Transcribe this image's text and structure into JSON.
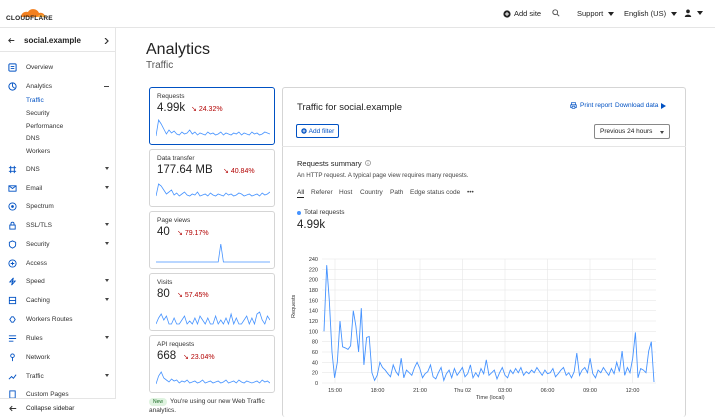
{
  "topbar": {
    "logo_text": "CLOUDFLARE",
    "add_site": "Add site",
    "support": "Support",
    "language": "English (US)"
  },
  "sidebar": {
    "domain": "social.example",
    "items": [
      {
        "label": "Overview",
        "icon": "overview-icon"
      },
      {
        "label": "Analytics",
        "icon": "analytics-icon"
      },
      {
        "label": "DNS",
        "icon": "dns-icon"
      },
      {
        "label": "Email",
        "icon": "email-icon"
      },
      {
        "label": "Spectrum",
        "icon": "spectrum-icon"
      },
      {
        "label": "SSL/TLS",
        "icon": "lock-icon"
      },
      {
        "label": "Security",
        "icon": "shield-icon"
      },
      {
        "label": "Access",
        "icon": "access-icon"
      },
      {
        "label": "Speed",
        "icon": "lightning-icon"
      },
      {
        "label": "Caching",
        "icon": "caching-icon"
      },
      {
        "label": "Workers Routes",
        "icon": "workers-icon"
      },
      {
        "label": "Rules",
        "icon": "rules-icon"
      },
      {
        "label": "Network",
        "icon": "network-icon"
      },
      {
        "label": "Traffic",
        "icon": "traffic-icon"
      },
      {
        "label": "Custom Pages",
        "icon": "pages-icon"
      }
    ],
    "analytics_sub": [
      "Traffic",
      "Security",
      "Performance",
      "DNS",
      "Workers"
    ],
    "collapse": "Collapse sidebar"
  },
  "main": {
    "title": "Analytics",
    "subtitle": "Traffic"
  },
  "cards": [
    {
      "label": "Requests",
      "value": "4.99k",
      "delta": "24.32%"
    },
    {
      "label": "Data transfer",
      "value": "177.64 MB",
      "delta": "40.84%"
    },
    {
      "label": "Page views",
      "value": "40",
      "delta": "79.17%"
    },
    {
      "label": "Visits",
      "value": "80",
      "delta": "57.45%"
    },
    {
      "label": "API requests",
      "value": "668",
      "delta": "23.04%"
    }
  ],
  "notice": {
    "badge": "New",
    "text_line1": "You're using our new Web Traffic",
    "text_line2": "analytics."
  },
  "panel": {
    "title": "Traffic for social.example",
    "print_report": "Print report",
    "download_data": "Download data",
    "add_filter": "Add filter",
    "time_range": "Previous 24 hours",
    "summary_title": "Requests summary",
    "summary_desc": "An HTTP request. A typical page view requires many requests.",
    "tabs": [
      "All",
      "Referer",
      "Host",
      "Country",
      "Path",
      "Edge status code",
      "•••"
    ],
    "legend_label": "Total requests",
    "total": "4.99k"
  },
  "chart_data": {
    "type": "line",
    "xlabel": "Time (local)",
    "ylabel": "Requests",
    "ylim": [
      0,
      240
    ],
    "yticks": [
      0,
      20,
      40,
      60,
      80,
      100,
      120,
      140,
      160,
      180,
      200,
      220,
      240
    ],
    "xticks": [
      "15:00",
      "18:00",
      "21:00",
      "Thu 02",
      "03:00",
      "06:00",
      "09:00",
      "12:00"
    ],
    "series": [
      {
        "name": "Total requests",
        "color": "#4693ff",
        "values": [
          100,
          228,
          160,
          60,
          10,
          40,
          120,
          70,
          68,
          65,
          72,
          140,
          110,
          60,
          145,
          35,
          88,
          90,
          20,
          5,
          15,
          40,
          30,
          25,
          18,
          12,
          35,
          22,
          15,
          48,
          10,
          25,
          20,
          15,
          30,
          40,
          28,
          10,
          18,
          22,
          35,
          12,
          8,
          20,
          30,
          5,
          18,
          25,
          10,
          28,
          15,
          22,
          30,
          12,
          18,
          35,
          10,
          20,
          12,
          28,
          18,
          45,
          15,
          20,
          25,
          8,
          20,
          30,
          15,
          10,
          25,
          18,
          28,
          20,
          30,
          15,
          22,
          18,
          25,
          20,
          30,
          22,
          15,
          25,
          18,
          20,
          28,
          12,
          18,
          25,
          30,
          15,
          20,
          10,
          22,
          58,
          15,
          25,
          30,
          20,
          48,
          18,
          10,
          25,
          20,
          30,
          22,
          15,
          28,
          18,
          40,
          22,
          62,
          15,
          30,
          20,
          48,
          98,
          10,
          28,
          25,
          20,
          62,
          80,
          2
        ]
      }
    ]
  }
}
